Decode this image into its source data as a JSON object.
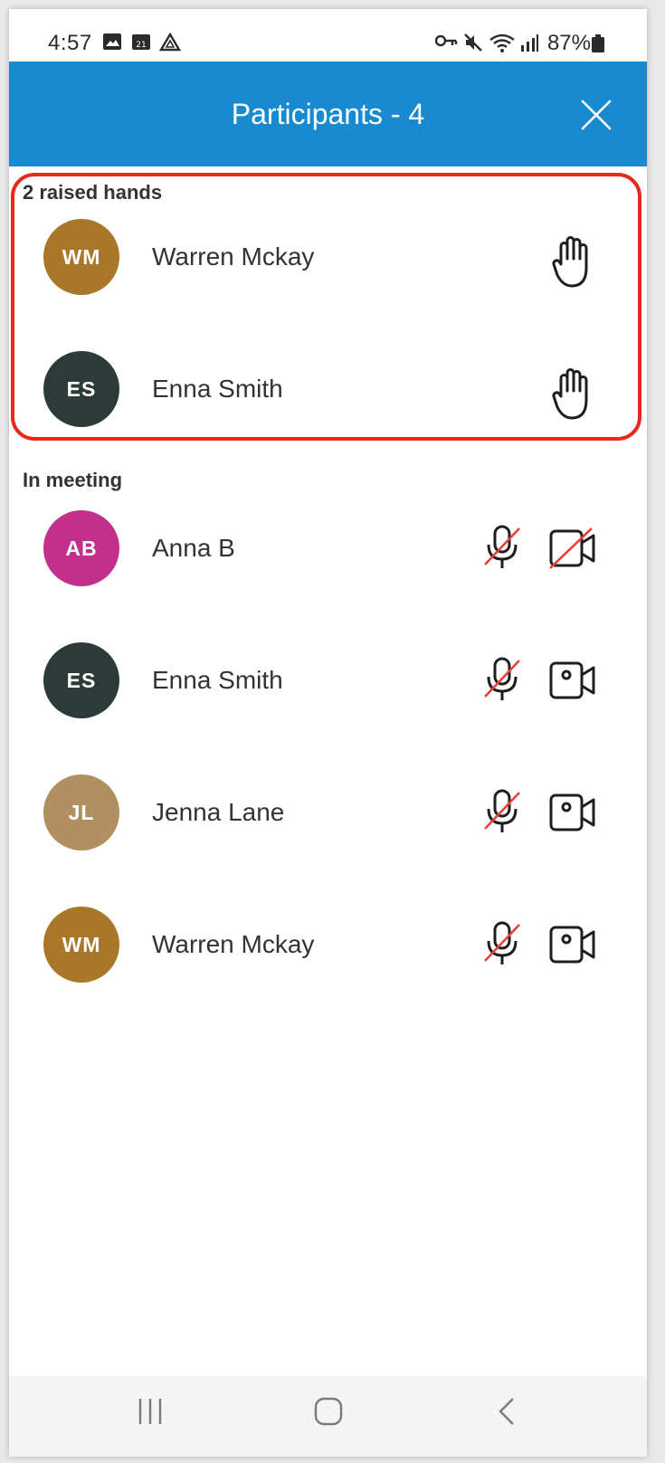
{
  "status_bar": {
    "time": "4:57",
    "battery": "87%"
  },
  "header": {
    "title": "Participants - 4"
  },
  "raised_section": {
    "label": "2 raised hands",
    "participants": [
      {
        "initials": "WM",
        "name": "Warren Mckay",
        "color": "#a8772a"
      },
      {
        "initials": "ES",
        "name": "Enna Smith",
        "color": "#2c3b38"
      }
    ]
  },
  "meeting_section": {
    "label": "In meeting",
    "participants": [
      {
        "initials": "AB",
        "name": "Anna B",
        "color": "#c2308b",
        "mic": "muted",
        "camera": "off"
      },
      {
        "initials": "ES",
        "name": "Enna Smith",
        "color": "#2c3b38",
        "mic": "muted",
        "camera": "on"
      },
      {
        "initials": "JL",
        "name": "Jenna Lane",
        "color": "#b09060",
        "mic": "muted",
        "camera": "on"
      },
      {
        "initials": "WM",
        "name": "Warren Mckay",
        "color": "#a8772a",
        "mic": "muted",
        "camera": "on"
      }
    ]
  },
  "colors": {
    "header_bg": "#1a8ad0",
    "highlight_border": "#e8291d",
    "mute_slash": "#e8413a"
  }
}
